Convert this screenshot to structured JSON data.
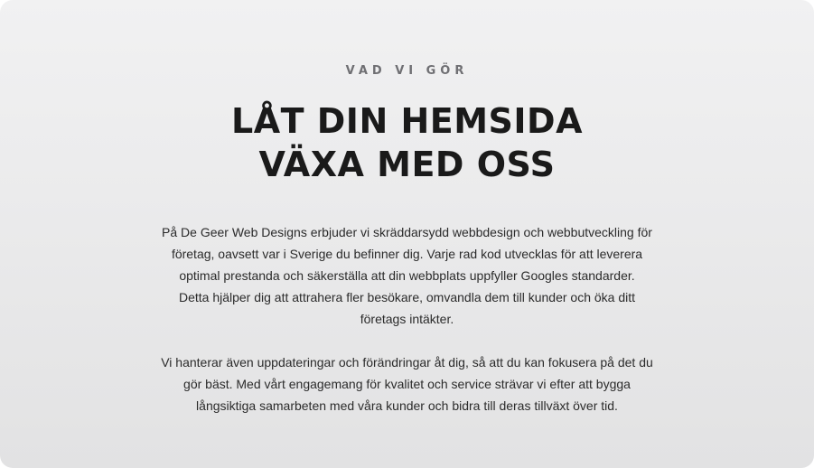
{
  "section": {
    "eyebrow": "VAD VI GÖR",
    "headline_lines": [
      "LÅT DIN HEMSIDA",
      "VÄXA MED OSS"
    ],
    "paragraph1_lines": [
      "På De Geer Web Designs erbjuder vi skräddarsydd webbdesign och webbutveckling för",
      "företag, oavsett var i Sverige du befinner dig. Varje rad kod utvecklas för att leverera",
      "optimal prestanda och säkerställa att din webbplats uppfyller Googles standarder.",
      "Detta hjälper dig att attrahera fler besökare, omvandla dem till kunder och öka ditt",
      "företags intäkter."
    ],
    "paragraph2_lines": [
      "Vi hanterar även uppdateringar och förändringar åt dig, så att du kan fokusera på det du",
      "gör bäst. Med vårt engagemang för kvalitet och service strävar vi efter att bygga",
      "långsiktiga samarbeten med våra kunder och bidra till deras tillväxt över tid."
    ]
  },
  "colors": {
    "background": "#ececed",
    "heading": "#1a1a1a",
    "eyebrow": "#6f6f73",
    "body_text": "#2b2b2b"
  }
}
